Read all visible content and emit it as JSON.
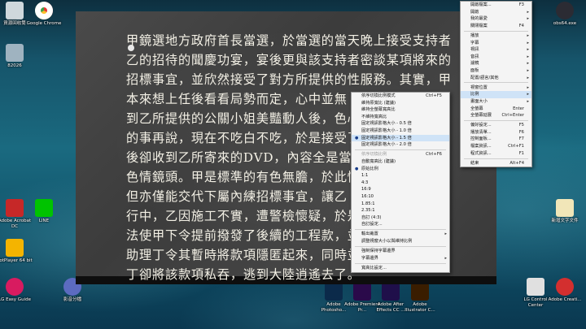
{
  "desktop_icons": [
    {
      "name": "recycle-bin-icon",
      "label": "資源回收筒",
      "color": "#cfd8dc"
    },
    {
      "name": "chrome-icon",
      "label": "Google Chrome",
      "color": "#e53935"
    },
    {
      "name": "monitor-icon",
      "label": "82026",
      "color": "#9fb3c0"
    },
    {
      "name": "acrobat-icon",
      "label": "Adobe Acrobat DC",
      "color": "#c62828"
    },
    {
      "name": "line-icon",
      "label": "LINE",
      "color": "#00c300"
    },
    {
      "name": "potplayer-icon",
      "label": "PotPlayer 64 bit",
      "color": "#f4b400"
    },
    {
      "name": "lg-guide-icon",
      "label": "LG Easy Guide",
      "color": "#d81b60"
    },
    {
      "name": "media-player-icon",
      "label": "影音分檔",
      "color": "#5c6bc0"
    },
    {
      "name": "photoshop-icon",
      "label": "Adobe Photosho...",
      "color": "#0b2a4a"
    },
    {
      "name": "premiere-icon",
      "label": "Adobe Premiere Pr...",
      "color": "#2a0a4a"
    },
    {
      "name": "after-effects-icon",
      "label": "Adobe After Effects CC ...",
      "color": "#1f0f4a"
    },
    {
      "name": "illustrator-icon",
      "label": "Adobe Illustrator C...",
      "color": "#3a1d00"
    },
    {
      "name": "lg-control-icon",
      "label": "LG Control Center",
      "color": "#e0e0e0"
    },
    {
      "name": "creative-cloud-icon",
      "label": "Adobe Creati...",
      "color": "#d32f2f"
    },
    {
      "name": "text-file-icon",
      "label": "新增文字文件",
      "color": "#f1e6b8"
    },
    {
      "name": "obs-icon",
      "label": "obs64.exe",
      "color": "#2b2b33"
    }
  ],
  "video": {
    "lines": [
      "甲鏡選地方政府首長當選，於當選的當天晚上接受支持者",
      "乙的招待的聞慶功宴，宴後更與該支持者密談某項將來的",
      "招標事宜，並欣然接受了對方所提供的性服務。其實，甲",
      "本來想上任後看看局勢而定，心中並無",
      "到乙所提供的公關小姐美豔動人後，色心",
      "的事再說，現在不吃白不吃，於是接受了",
      "後卻收到乙所寄來的DVD，內容全是當晚",
      "色情鏡頭。甲是標準的有色無膽，於此情",
      "但亦僅能交代下屬內練招標事宜，讓乙",
      "行中，乙因施工不實，遭警檢懷疑，於是",
      "法使甲下令提前撥發了後續的工程款，並",
      "助理丁令其暫時將款項隱匿起來，同時並",
      "丁卻將該款項私吞，逃到大陸逍遙去了。"
    ]
  },
  "main_menu": [
    {
      "label": "開啟檔案...",
      "shortcut": "F3"
    },
    {
      "label": "開啟",
      "arrow": true
    },
    {
      "label": "我的最愛",
      "arrow": true
    },
    {
      "label": "關閉檔案",
      "shortcut": "F4"
    },
    {
      "sep": true
    },
    {
      "label": "播放",
      "arrow": true
    },
    {
      "label": "字幕",
      "arrow": true
    },
    {
      "label": "視訊",
      "arrow": true
    },
    {
      "label": "音訊",
      "arrow": true
    },
    {
      "label": "濾鏡",
      "arrow": true
    },
    {
      "label": "面板",
      "arrow": true
    },
    {
      "label": "配置/語言/其他",
      "arrow": true
    },
    {
      "sep": true
    },
    {
      "label": "視窗位置",
      "arrow": true
    },
    {
      "label": "比例",
      "arrow": true,
      "highlight": true
    },
    {
      "label": "畫面大小",
      "arrow": true
    },
    {
      "label": "全螢幕",
      "shortcut": "Enter"
    },
    {
      "label": "全螢幕延展",
      "shortcut": "Ctrl+Enter"
    },
    {
      "sep": true
    },
    {
      "label": "偏好設定...",
      "shortcut": "F5"
    },
    {
      "label": "播放清單...",
      "shortcut": "F6"
    },
    {
      "label": "控制面板...",
      "shortcut": "F7"
    },
    {
      "label": "檔案資訊...",
      "shortcut": "Ctrl+F1"
    },
    {
      "label": "程式資訊...",
      "shortcut": "F1"
    },
    {
      "sep": true
    },
    {
      "label": "結束",
      "shortcut": "Alt+F4"
    }
  ],
  "ratio_menu": [
    {
      "label": "依序切換比例模式",
      "shortcut": "Ctrl+F5"
    },
    {
      "label": "維持原寬比 (建議)"
    },
    {
      "label": "維持全螢幕寬高比"
    },
    {
      "label": "不維持寬高比"
    },
    {
      "label": "固定視訊影格大小 - 0.5 倍"
    },
    {
      "label": "固定視訊影格大小 - 1.0 倍"
    },
    {
      "label": "固定視訊影格大小 - 1.5 倍",
      "checked": true,
      "highlight": true
    },
    {
      "label": "固定視訊影格大小 - 2.0 倍"
    },
    {
      "sep": true
    },
    {
      "label": "依序切換比例",
      "shortcut": "Ctrl+F6",
      "dim": true
    },
    {
      "label": "自動寬高比 (建議)"
    },
    {
      "label": "原始比例",
      "checked": true
    },
    {
      "label": "1:1"
    },
    {
      "label": "4:3"
    },
    {
      "label": "16:9"
    },
    {
      "label": "16:10"
    },
    {
      "label": "1.85:1"
    },
    {
      "label": "2.35:1"
    },
    {
      "label": "自訂 (4:3)"
    },
    {
      "label": "自訂設定..."
    },
    {
      "sep": true
    },
    {
      "label": "輸出裁置",
      "arrow": true
    },
    {
      "label": "調整視窗大小以與維持比例"
    },
    {
      "sep": true
    },
    {
      "label": "強制保持字幕邊界"
    },
    {
      "label": "字幕邊界",
      "arrow": true
    },
    {
      "sep": true
    },
    {
      "label": "寬高比設定..."
    }
  ]
}
